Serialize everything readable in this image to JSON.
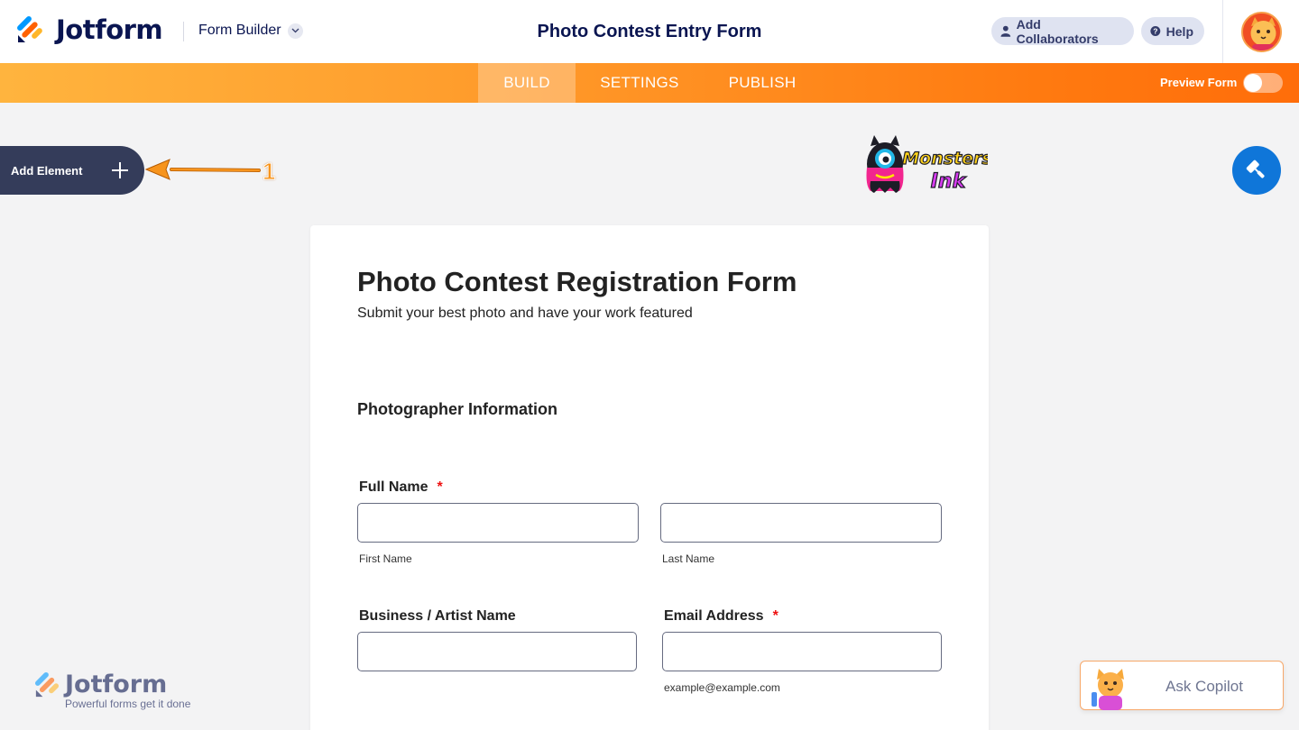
{
  "header": {
    "brand": "Jotform",
    "mode_label": "Form Builder",
    "title": "Photo Contest Entry Form",
    "add_collaborators": "Add Collaborators",
    "help": "Help"
  },
  "nav": {
    "tabs": [
      {
        "label": "BUILD",
        "active": true
      },
      {
        "label": "SETTINGS",
        "active": false
      },
      {
        "label": "PUBLISH",
        "active": false
      }
    ],
    "preview_label": "Preview Form",
    "preview_on": false
  },
  "sidebar": {
    "add_element_label": "Add Element",
    "annotation_number": "1"
  },
  "form": {
    "title": "Photo Contest Registration Form",
    "subtitle": "Submit your best photo and have your work featured",
    "section": "Photographer Information",
    "full_name": {
      "label": "Full Name",
      "required": "*",
      "first_sublabel": "First Name",
      "last_sublabel": "Last Name"
    },
    "business": {
      "label": "Business / Artist Name"
    },
    "email": {
      "label": "Email Address",
      "required": "*",
      "sublabel": "example@example.com"
    }
  },
  "logo": {
    "line1": "Monsters",
    "line2": "Ink"
  },
  "footer": {
    "brand": "Jotform",
    "tagline": "Powerful forms get it done"
  },
  "copilot": {
    "label": "Ask Copilot"
  },
  "colors": {
    "navy": "#0a1551",
    "orange": "#ff7a10",
    "blue": "#0f76d9",
    "add_element_bg": "#343c5a"
  }
}
